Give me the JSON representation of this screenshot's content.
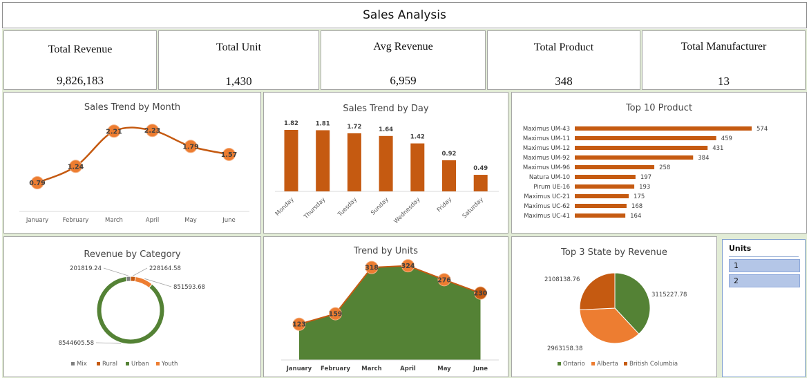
{
  "header": {
    "title": "Sales Analysis"
  },
  "kpis": {
    "total_revenue": {
      "label": "Total Revenue",
      "value": "9,826,183"
    },
    "total_unit": {
      "label": "Total Unit",
      "value": "1,430"
    },
    "avg_revenue": {
      "label": "Avg Revenue",
      "value": "6,959"
    },
    "total_product": {
      "label": "Total Product",
      "value": "348"
    },
    "total_manufacturer": {
      "label": "Total Manufacturer",
      "value": "13"
    }
  },
  "colors": {
    "orange_dark": "#c55a11",
    "orange": "#ed7d31",
    "green": "#548235",
    "grey": "#7f7f7f",
    "slicer": "#b4c6e7"
  },
  "slicer": {
    "header": "Units",
    "items": [
      "1",
      "2"
    ]
  },
  "chart_data": [
    {
      "id": "month",
      "type": "line",
      "title": "Sales Trend by Month",
      "categories": [
        "January",
        "February",
        "March",
        "April",
        "May",
        "June"
      ],
      "values": [
        0.79,
        1.24,
        2.21,
        2.23,
        1.79,
        1.57
      ],
      "labels": [
        "0.79",
        "1.24",
        "2.21",
        "2.23",
        "1.79",
        "1.57"
      ],
      "ylim": [
        0,
        2.6
      ]
    },
    {
      "id": "day",
      "type": "bar",
      "title": "Sales Trend by Day",
      "categories": [
        "Monday",
        "Thursday",
        "Tuesday",
        "Sunday",
        "Wednesday",
        "Friday",
        "Saturday"
      ],
      "values": [
        1.82,
        1.81,
        1.72,
        1.64,
        1.42,
        0.92,
        0.49
      ],
      "labels": [
        "1.82",
        "1.81",
        "1.72",
        "1.64",
        "1.42",
        "0.92",
        "0.49"
      ],
      "ylim": [
        0,
        1.82
      ]
    },
    {
      "id": "product",
      "type": "bar",
      "orientation": "horizontal",
      "title": "Top 10 Product",
      "categories": [
        "Maximus UM-43",
        "Maximus UM-11",
        "Maximus UM-12",
        "Maximus UM-92",
        "Maximus UM-96",
        "Natura UM-10",
        "Pirum UE-16",
        "Maximus UC-21",
        "Maximus UC-62",
        "Maximus UC-41"
      ],
      "values": [
        574,
        459,
        431,
        384,
        258,
        197,
        193,
        175,
        168,
        164
      ],
      "labels": [
        "574",
        "459",
        "431",
        "384",
        "258",
        "197",
        "193",
        "175",
        "168",
        "164"
      ],
      "xlim": [
        0,
        574
      ]
    },
    {
      "id": "category",
      "type": "pie",
      "style": "doughnut",
      "title": "Revenue by Category",
      "categories": [
        "Mix",
        "Rural",
        "Urban",
        "Youth"
      ],
      "values": [
        201819.24,
        228164.58,
        8544605.58,
        851593.68
      ],
      "labels": [
        "201819.24",
        "228164.58",
        "8544605.58",
        "851593.68"
      ],
      "colors": [
        "#7f7f7f",
        "#c55a11",
        "#548235",
        "#ed7d31"
      ],
      "legend": "bottom"
    },
    {
      "id": "units",
      "type": "area",
      "title": "Trend by Units",
      "categories": [
        "January",
        "February",
        "March",
        "April",
        "May",
        "June"
      ],
      "values": [
        123,
        159,
        318,
        324,
        276,
        230
      ],
      "labels": [
        "123",
        "159",
        "318",
        "324",
        "276",
        "230"
      ],
      "ylim": [
        0,
        340
      ]
    },
    {
      "id": "state",
      "type": "pie",
      "title": "Top 3 State by Revenue",
      "categories": [
        "Ontario",
        "Alberta",
        "British Columbia"
      ],
      "values": [
        3115227.78,
        2963158.38,
        2108138.76
      ],
      "labels": [
        "3115227.78",
        "2963158.38",
        "2108138.76"
      ],
      "colors": [
        "#548235",
        "#ed7d31",
        "#c55a11"
      ],
      "legend": "bottom"
    }
  ]
}
